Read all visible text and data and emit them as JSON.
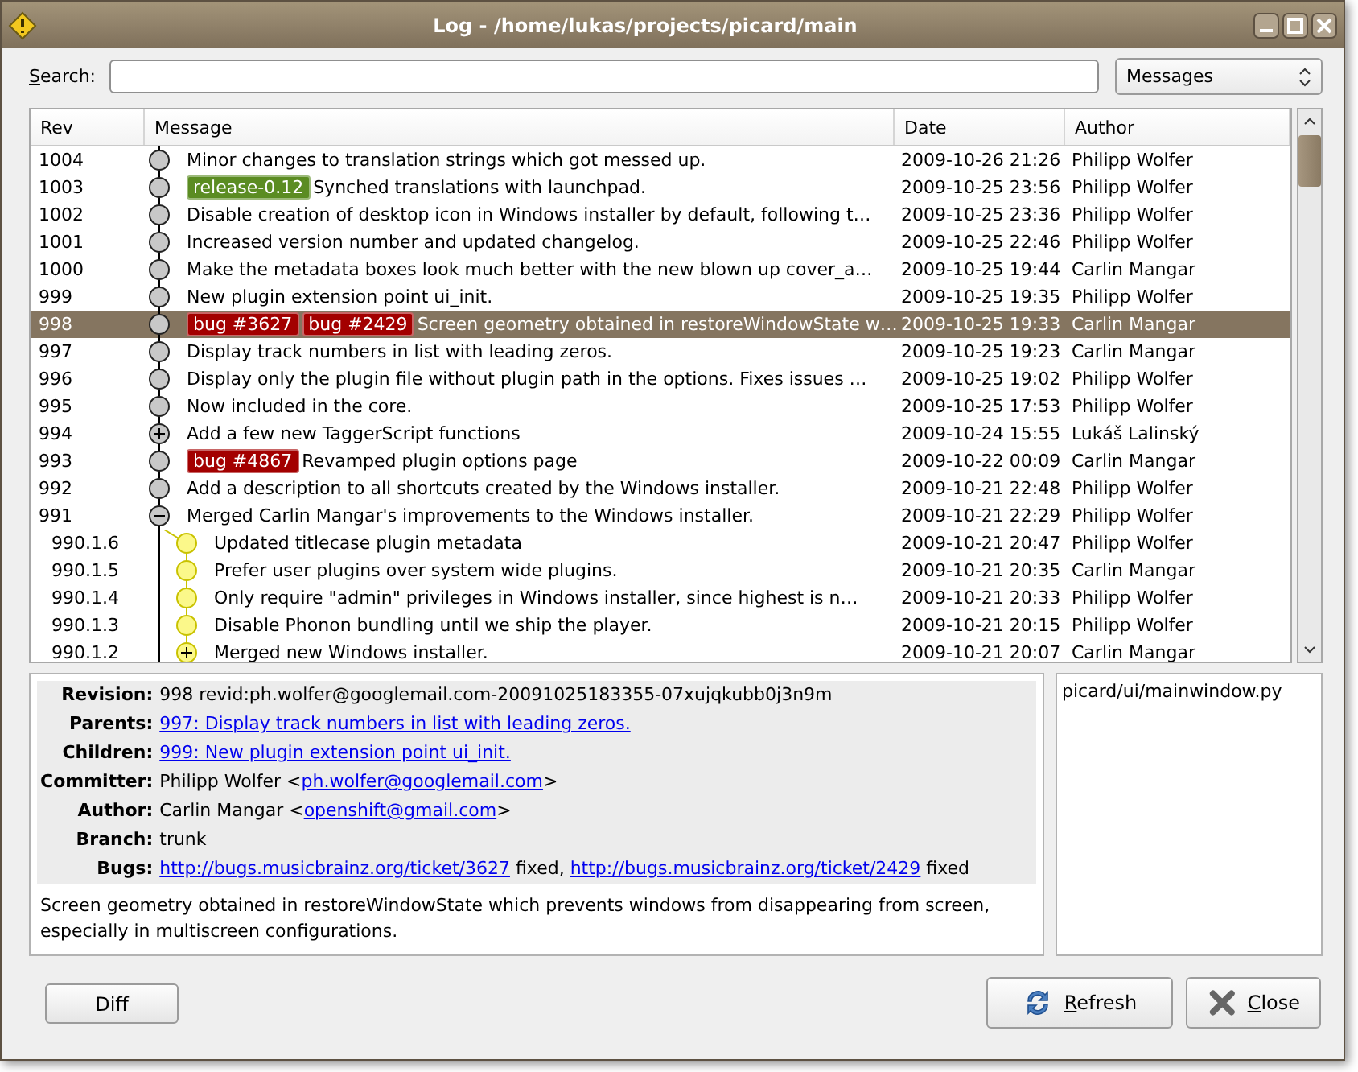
{
  "window": {
    "title": "Log - /home/lukas/projects/picard/main"
  },
  "search": {
    "label": "Search:",
    "mnemonic": true,
    "scope": "Messages"
  },
  "table": {
    "columns": [
      "Rev",
      "Message",
      "Date",
      "Author"
    ],
    "rows": [
      {
        "rev": "1004",
        "tags": [],
        "message": "Minor changes to translation strings which got messed up.",
        "date": "2009-10-26 21:26",
        "author": "Philipp Wolfer",
        "kind": "commit",
        "branch": false,
        "selected": false
      },
      {
        "rev": "1003",
        "tags": [
          {
            "label": "release-0.12",
            "color": "#5b8c22"
          }
        ],
        "message": "Synched translations with launchpad.",
        "date": "2009-10-25 23:56",
        "author": "Philipp Wolfer",
        "kind": "commit",
        "branch": false,
        "selected": false
      },
      {
        "rev": "1002",
        "tags": [],
        "message": "Disable creation of desktop icon in Windows installer by default, following t…",
        "date": "2009-10-25 23:36",
        "author": "Philipp Wolfer",
        "kind": "commit",
        "branch": false,
        "selected": false
      },
      {
        "rev": "1001",
        "tags": [],
        "message": "Increased version number and updated changelog.",
        "date": "2009-10-25 22:46",
        "author": "Philipp Wolfer",
        "kind": "commit",
        "branch": false,
        "selected": false
      },
      {
        "rev": "1000",
        "tags": [],
        "message": "Make the metadata boxes look much better with the new blown up cover_a…",
        "date": "2009-10-25 19:44",
        "author": "Carlin Mangar",
        "kind": "commit",
        "branch": false,
        "selected": false
      },
      {
        "rev": "999",
        "tags": [],
        "message": "New plugin extension point ui_init.",
        "date": "2009-10-25 19:35",
        "author": "Philipp Wolfer",
        "kind": "commit",
        "branch": false,
        "selected": false
      },
      {
        "rev": "998",
        "tags": [
          {
            "label": "bug #3627",
            "color": "#a30000"
          },
          {
            "label": "bug #2429",
            "color": "#a30000"
          }
        ],
        "message": "Screen geometry obtained in restoreWindowState w…",
        "date": "2009-10-25 19:33",
        "author": "Carlin Mangar",
        "kind": "commit",
        "branch": false,
        "selected": true
      },
      {
        "rev": "997",
        "tags": [],
        "message": "Display track numbers in list with leading zeros.",
        "date": "2009-10-25 19:23",
        "author": "Carlin Mangar",
        "kind": "commit",
        "branch": false,
        "selected": false
      },
      {
        "rev": "996",
        "tags": [],
        "message": "Display only the plugin file without plugin path in the options. Fixes issues …",
        "date": "2009-10-25 19:02",
        "author": "Philipp Wolfer",
        "kind": "commit",
        "branch": false,
        "selected": false
      },
      {
        "rev": "995",
        "tags": [],
        "message": "Now included in the core.",
        "date": "2009-10-25 17:53",
        "author": "Philipp Wolfer",
        "kind": "commit",
        "branch": false,
        "selected": false
      },
      {
        "rev": "994",
        "tags": [],
        "message": "Add a few new TaggerScript functions",
        "date": "2009-10-24 15:55",
        "author": "Lukáš Lalinský",
        "kind": "expandable",
        "branch": false,
        "selected": false
      },
      {
        "rev": "993",
        "tags": [
          {
            "label": "bug #4867",
            "color": "#a30000"
          }
        ],
        "message": "Revamped plugin options page",
        "date": "2009-10-22 00:09",
        "author": "Carlin Mangar",
        "kind": "commit",
        "branch": false,
        "selected": false
      },
      {
        "rev": "992",
        "tags": [],
        "message": "Add a description to all shortcuts created by the Windows installer.",
        "date": "2009-10-21 22:48",
        "author": "Philipp Wolfer",
        "kind": "commit",
        "branch": false,
        "selected": false
      },
      {
        "rev": "991",
        "tags": [],
        "message": "Merged Carlin Mangar's improvements to the Windows installer.",
        "date": "2009-10-21 22:29",
        "author": "Philipp Wolfer",
        "kind": "collapsible",
        "branch": false,
        "selected": false
      },
      {
        "rev": "990.1.6",
        "tags": [],
        "message": "Updated titlecase plugin metadata",
        "date": "2009-10-21 20:47",
        "author": "Philipp Wolfer",
        "kind": "commit",
        "branch": true,
        "selected": false
      },
      {
        "rev": "990.1.5",
        "tags": [],
        "message": "Prefer user plugins over system wide plugins.",
        "date": "2009-10-21 20:35",
        "author": "Carlin Mangar",
        "kind": "commit",
        "branch": true,
        "selected": false
      },
      {
        "rev": "990.1.4",
        "tags": [],
        "message": "Only require \"admin\" privileges in Windows installer, since highest is n…",
        "date": "2009-10-21 20:33",
        "author": "Philipp Wolfer",
        "kind": "commit",
        "branch": true,
        "selected": false
      },
      {
        "rev": "990.1.3",
        "tags": [],
        "message": "Disable Phonon bundling until we ship the player.",
        "date": "2009-10-21 20:15",
        "author": "Philipp Wolfer",
        "kind": "commit",
        "branch": true,
        "selected": false
      },
      {
        "rev": "990.1.2",
        "tags": [],
        "message": "Merged new Windows installer.",
        "date": "2009-10-21 20:07",
        "author": "Carlin Mangar",
        "kind": "expandable",
        "branch": true,
        "selected": false
      }
    ]
  },
  "details": {
    "fields": [
      {
        "label": "Revision:",
        "parts": [
          {
            "kind": "text",
            "text": "998 revid:ph.wolfer@googlemail.com-20091025183355-07xujqkubb0j3n9m"
          }
        ]
      },
      {
        "label": "Parents:",
        "parts": [
          {
            "kind": "link",
            "text": "997: Display track numbers in list with leading zeros."
          }
        ]
      },
      {
        "label": "Children:",
        "parts": [
          {
            "kind": "link",
            "text": "999: New plugin extension point ui_init."
          }
        ]
      },
      {
        "label": "Committer:",
        "parts": [
          {
            "kind": "text",
            "text": "Philipp Wolfer <"
          },
          {
            "kind": "link",
            "text": "ph.wolfer@googlemail.com"
          },
          {
            "kind": "text",
            "text": ">"
          }
        ]
      },
      {
        "label": "Author:",
        "parts": [
          {
            "kind": "text",
            "text": "Carlin Mangar <"
          },
          {
            "kind": "link",
            "text": "openshift@gmail.com"
          },
          {
            "kind": "text",
            "text": ">"
          }
        ]
      },
      {
        "label": "Branch:",
        "parts": [
          {
            "kind": "text",
            "text": "trunk"
          }
        ]
      },
      {
        "label": "Bugs:",
        "parts": [
          {
            "kind": "link",
            "text": "http://bugs.musicbrainz.org/ticket/3627"
          },
          {
            "kind": "text",
            "text": " fixed, "
          },
          {
            "kind": "link",
            "text": "http://bugs.musicbrainz.org/ticket/2429"
          },
          {
            "kind": "text",
            "text": " fixed"
          }
        ]
      }
    ],
    "description": "Screen geometry obtained in restoreWindowState which prevents windows from disappearing from screen, especially in multiscreen configurations."
  },
  "files": [
    "picard/ui/mainwindow.py"
  ],
  "buttons": [
    {
      "label": "Diff",
      "mnemonic": false
    },
    {
      "label": "Refresh",
      "mnemonic": true
    },
    {
      "label": "Close",
      "mnemonic": true
    }
  ]
}
